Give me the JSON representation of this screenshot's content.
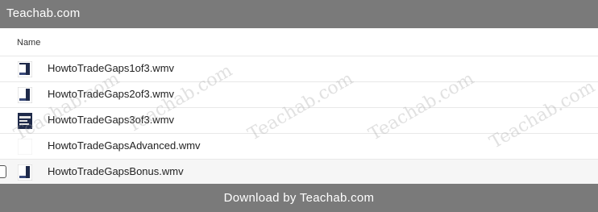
{
  "header": {
    "title": "Teachab.com"
  },
  "list": {
    "column_name": "Name",
    "files": [
      {
        "name": "HowtoTradeGaps1of3.wmv",
        "icon": "video-thumbnail-icon"
      },
      {
        "name": "HowtoTradeGaps2of3.wmv",
        "icon": "video-thumbnail-icon"
      },
      {
        "name": "HowtoTradeGaps3of3.wmv",
        "icon": "video-thumbnail-icon"
      },
      {
        "name": "HowtoTradeGapsAdvanced.wmv",
        "icon": "blank-file-icon"
      },
      {
        "name": "HowtoTradeGapsBonus.wmv",
        "icon": "video-thumbnail-icon"
      }
    ]
  },
  "watermark": {
    "text": "Teachab.com"
  },
  "footer": {
    "text": "Download by Teachab.com"
  },
  "colors": {
    "bar": "#7a7a7a",
    "icon_dark": "#1f2a4a"
  }
}
